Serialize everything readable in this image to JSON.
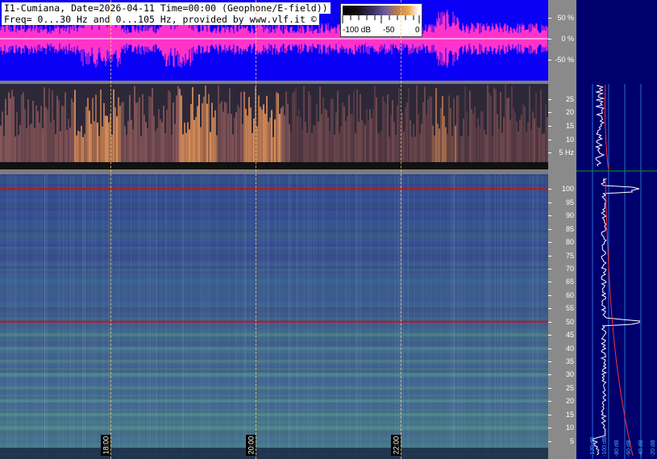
{
  "header": {
    "line1": "I1-Cumiana, Date=2026-04-11 Time=00:00 (Geophone/E-field))",
    "line2": "Freq= 0...30 Hz and 0...105 Hz, provided by www.vlf.it ©"
  },
  "colorbar": {
    "labels": [
      "-100 dB",
      "-50",
      "0"
    ]
  },
  "colors": {
    "waveform_bg": "#0a00f5",
    "waveform_trace": "#ff33cc",
    "powerline": "#cc1111",
    "accent_text": "#ffffff"
  },
  "chart_data": [
    {
      "type": "line",
      "panel": "waveform",
      "ylabel_ticks": [
        "50 %",
        "0 %",
        "-50 %"
      ],
      "y_ticks": [
        50,
        0,
        -50
      ],
      "ylim": [
        -100,
        100
      ],
      "unit": "%"
    },
    {
      "type": "heatmap",
      "panel": "spectrogram-low",
      "y_ticks": [
        25,
        20,
        15,
        10,
        5
      ],
      "y_tick_labels": [
        "25",
        "20",
        "15",
        "10",
        "5 Hz"
      ],
      "ylim": [
        0,
        30
      ]
    },
    {
      "type": "heatmap",
      "panel": "spectrogram-high",
      "y_ticks": [
        100,
        95,
        90,
        85,
        80,
        75,
        70,
        65,
        60,
        55,
        50,
        45,
        40,
        35,
        30,
        25,
        20,
        15,
        10,
        5
      ],
      "ylim": [
        0,
        105
      ],
      "powerline_hz": [
        50,
        100
      ],
      "x_ticks": [
        "18:00",
        "20:00",
        "22:00"
      ]
    },
    {
      "type": "line",
      "panel": "profile",
      "x_tick_labels": [
        "-120 dB",
        "-100 dB",
        "-80 dB",
        "-60 dB",
        "-40 dB",
        "-20 dB"
      ]
    }
  ]
}
